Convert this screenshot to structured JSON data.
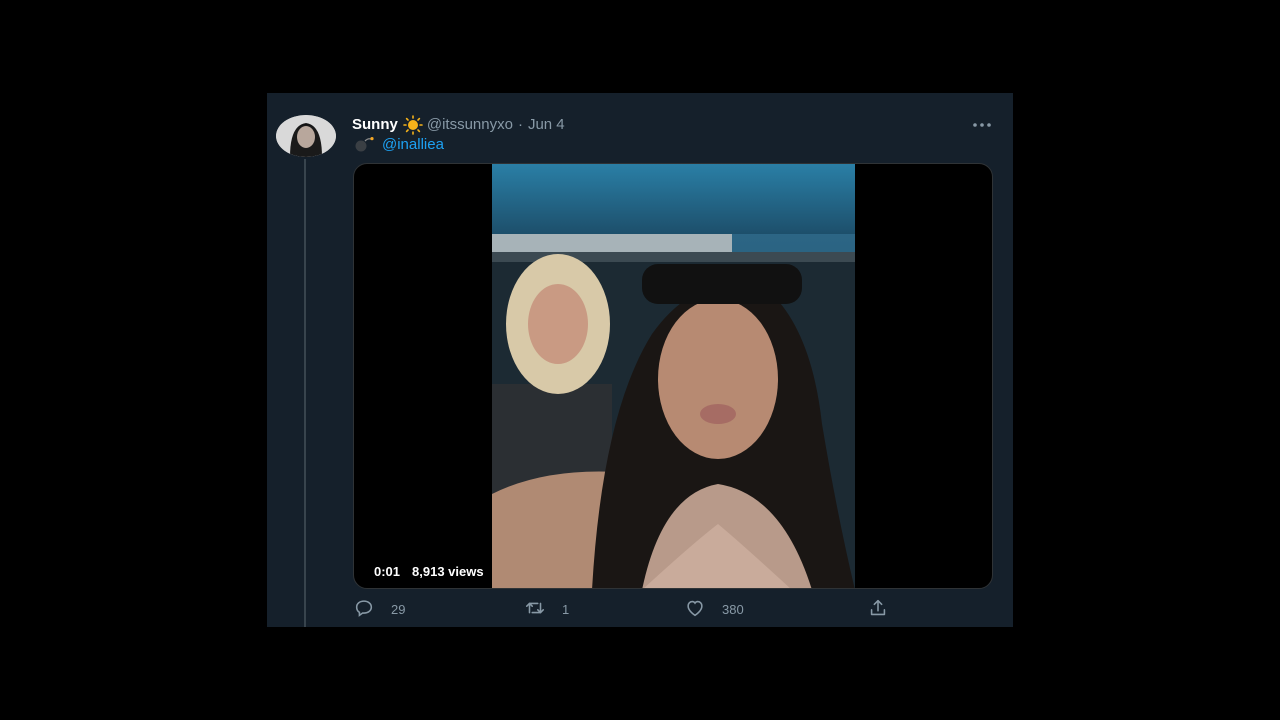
{
  "tweet": {
    "display_name": "Sunny",
    "display_name_emoji": "sun-icon",
    "handle": "@itssunnyxo",
    "separator": "·",
    "date": "Jun 4",
    "more_icon": "more-horizontal-icon",
    "reply_prefix_icon": "bomb-icon",
    "mention": "@inalliea"
  },
  "video": {
    "elapsed": "0:01",
    "views": "8,913 views"
  },
  "actions": {
    "reply": {
      "icon": "reply-icon",
      "count": "29"
    },
    "retweet": {
      "icon": "retweet-icon",
      "count": "1"
    },
    "like": {
      "icon": "heart-icon",
      "count": "380"
    },
    "share": {
      "icon": "share-icon"
    }
  },
  "colors": {
    "background": "#000000",
    "card": "#15202b",
    "text_primary": "#ffffff",
    "text_secondary": "#8899a6",
    "accent": "#1da1f2"
  }
}
